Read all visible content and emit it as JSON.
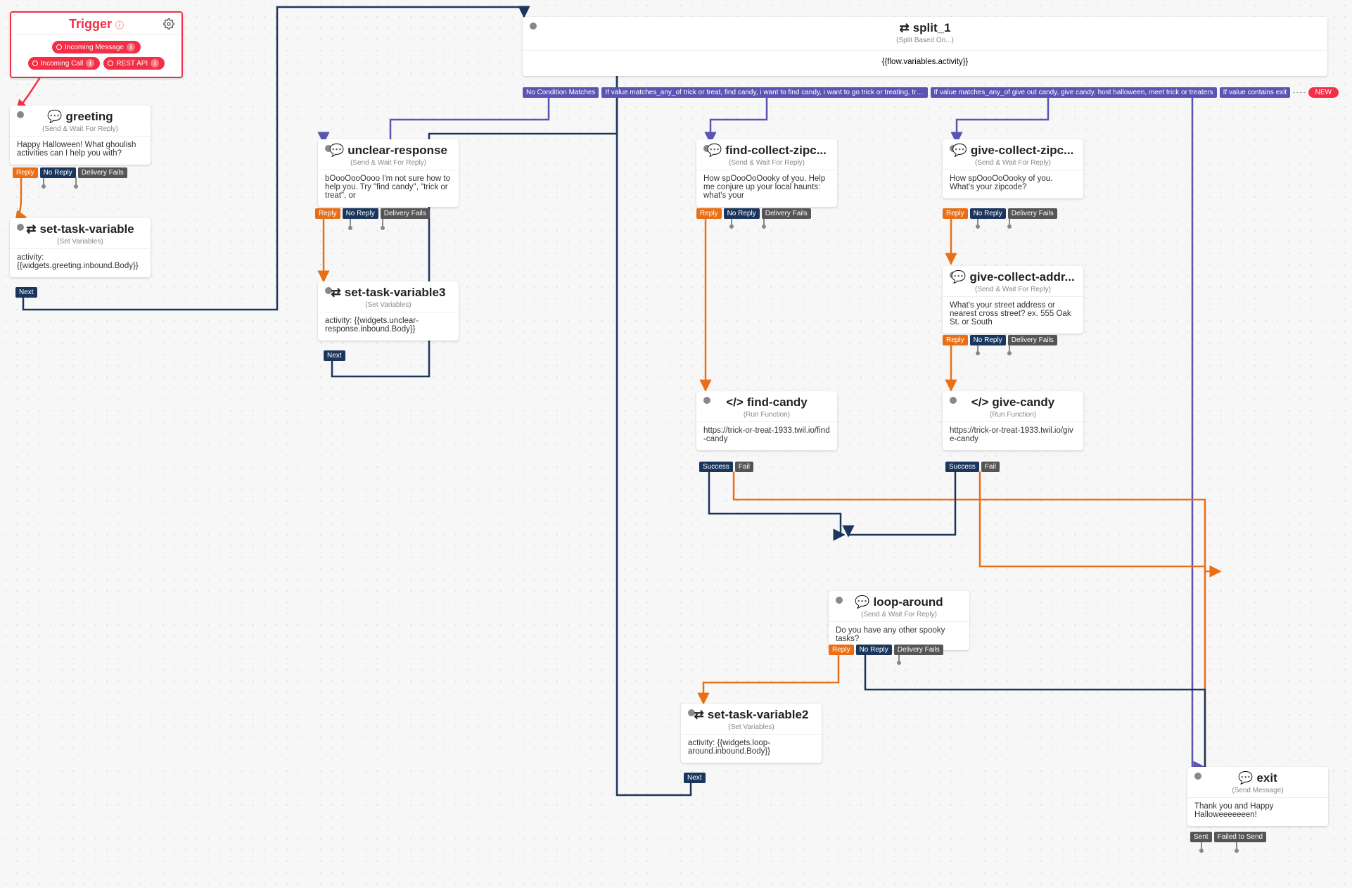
{
  "trigger": {
    "title": "Trigger",
    "pills": [
      "Incoming Message",
      "Incoming Call",
      "REST API"
    ]
  },
  "greeting": {
    "title": "greeting",
    "subtitle": "(Send & Wait For Reply)",
    "body": "Happy Halloween! What ghoulish activities can I help you with?",
    "tags": [
      "Reply",
      "No Reply",
      "Delivery Fails"
    ]
  },
  "set_task_variable": {
    "title": "set-task-variable",
    "subtitle": "(Set Variables)",
    "body": "activity: {{widgets.greeting.inbound.Body}}",
    "tags": [
      "Next"
    ]
  },
  "unclear_response": {
    "title": "unclear-response",
    "subtitle": "(Send & Wait For Reply)",
    "body": "bOooOooOooo I'm not sure how to help you. Try \"find candy\", \"trick or treat\", or",
    "tags": [
      "Reply",
      "No Reply",
      "Delivery Fails"
    ]
  },
  "set_task_variable3": {
    "title": "set-task-variable3",
    "subtitle": "(Set Variables)",
    "body": "activity: {{widgets.unclear-response.inbound.Body}}",
    "tags": [
      "Next"
    ]
  },
  "split1": {
    "title": "split_1",
    "subtitle": "(Split Based On...)",
    "body": "{{flow.variables.activity}}",
    "conditions": [
      "No Condition Matches",
      "If value matches_any_of trick or treat, find candy, i want to find candy, i want to go trick or treating, trick'r treat, where can i find candy, where can i go trick or treating",
      "If value matches_any_of give out candy, give candy, host halloween, meet trick or treaters",
      "If value contains exit"
    ],
    "new": "NEW"
  },
  "find_collect_zip": {
    "title": "find-collect-zipc...",
    "subtitle": "(Send & Wait For Reply)",
    "body": "How spOooOoOooky of you. Help me conjure up your local haunts: what's your",
    "tags": [
      "Reply",
      "No Reply",
      "Delivery Fails"
    ]
  },
  "give_collect_zip": {
    "title": "give-collect-zipc...",
    "subtitle": "(Send & Wait For Reply)",
    "body": "How spOooOoOooky of you. What's your zipcode?",
    "tags": [
      "Reply",
      "No Reply",
      "Delivery Fails"
    ]
  },
  "give_collect_addr": {
    "title": "give-collect-addr...",
    "subtitle": "(Send & Wait For Reply)",
    "body": "What's your street address or nearest cross street? ex. 555 Oak St. or South",
    "tags": [
      "Reply",
      "No Reply",
      "Delivery Fails"
    ]
  },
  "find_candy": {
    "title": "find-candy",
    "subtitle": "(Run Function)",
    "body": "https://trick-or-treat-1933.twil.io/find-candy",
    "tags": [
      "Success",
      "Fail"
    ]
  },
  "give_candy": {
    "title": "give-candy",
    "subtitle": "(Run Function)",
    "body": "https://trick-or-treat-1933.twil.io/give-candy",
    "tags": [
      "Success",
      "Fail"
    ]
  },
  "loop_around": {
    "title": "loop-around",
    "subtitle": "(Send & Wait For Reply)",
    "body": "Do you have any other spooky tasks?",
    "tags": [
      "Reply",
      "No Reply",
      "Delivery Fails"
    ]
  },
  "set_task_variable2": {
    "title": "set-task-variable2",
    "subtitle": "(Set Variables)",
    "body": "activity: {{widgets.loop-around.inbound.Body}}",
    "tags": [
      "Next"
    ]
  },
  "exit": {
    "title": "exit",
    "subtitle": "(Send Message)",
    "body": "Thank you and Happy Halloweeeeeeen!",
    "tags": [
      "Sent",
      "Failed to Send"
    ]
  }
}
